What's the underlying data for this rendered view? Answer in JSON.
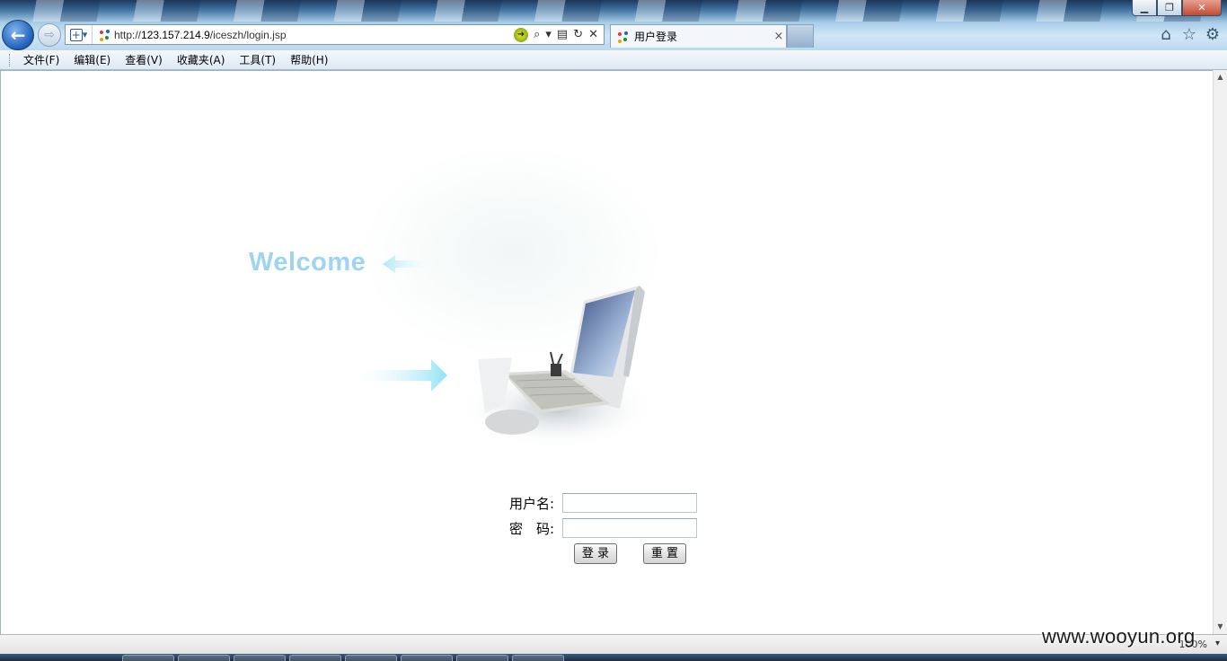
{
  "browser": {
    "url_prefix": "http://",
    "url_host": "123.157.214.9",
    "url_path": "/iceszh/login.jsp",
    "tab_title": "用户登录",
    "tab_close": "×",
    "win_min": "▁",
    "win_max": "❐",
    "win_close": "✕",
    "back_glyph": "←",
    "forward_glyph": "⇨",
    "compat_glyph": "+",
    "addr_icons": {
      "go": "➜",
      "search": "⌕",
      "dropdown": "▾",
      "compat_view": "▤",
      "refresh": "↻",
      "stop": "✕"
    },
    "right_icons": [
      "home-icon",
      "favorites-star-icon",
      "tools-gear-icon"
    ],
    "right_icon_glyphs": [
      "⌂",
      "☆",
      "⚙"
    ]
  },
  "menubar": {
    "items": [
      "文件(F)",
      "编辑(E)",
      "查看(V)",
      "收藏夹(A)",
      "工具(T)",
      "帮助(H)"
    ]
  },
  "page": {
    "hero_text": "Welcome",
    "login": {
      "username_label": "用户名:",
      "username_value": "",
      "password_label": "密　码:",
      "password_value": "",
      "login_button": "登 录",
      "reset_button": "重 置"
    }
  },
  "statusbar": {
    "zoom": "100%",
    "zoom_arrow": "▾"
  },
  "watermark": "www.wooyun.org"
}
